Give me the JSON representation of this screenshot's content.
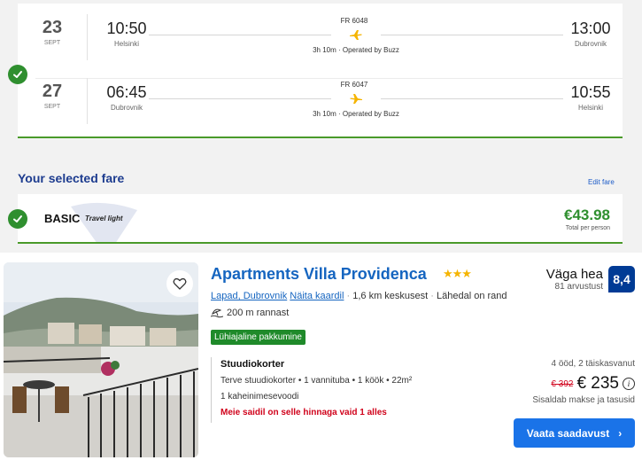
{
  "flights": [
    {
      "day": "23",
      "month": "SEPT",
      "dep_time": "10:50",
      "dep_city": "Helsinki",
      "flight_no": "FR 6048",
      "duration": "3h 10m · Operated by Buzz",
      "arr_time": "13:00",
      "arr_city": "Dubrovnik"
    },
    {
      "day": "27",
      "month": "SEPT",
      "dep_time": "06:45",
      "dep_city": "Dubrovnik",
      "flight_no": "FR 6047",
      "duration": "3h 10m · Operated by Buzz",
      "arr_time": "10:55",
      "arr_city": "Helsinki"
    }
  ],
  "fare": {
    "title": "Your selected fare",
    "edit": "Edit fare",
    "name": "BASIC",
    "subtitle": "Travel light",
    "price": "€43.98",
    "per": "Total per person"
  },
  "hotel": {
    "name": "Apartments Villa Providenca",
    "stars": "★★★",
    "location_link": "Lapad, Dubrovnik",
    "map_link": "Näita kaardil",
    "distance": "1,6 km keskusest",
    "beach_near": "Lähedal on rand",
    "beach_dist": "200 m rannast",
    "deal": "Lühiajaline pakkumine",
    "room": "Stuudiokorter",
    "room_details": "Terve stuudiokorter • 1 vannituba • 1 köök • 22m²",
    "bed": "1 kaheinimesevoodi",
    "availability": "Meie saidil on selle hinnaga vaid 1 alles",
    "rating_label": "Väga hea",
    "reviews": "81 arvustust",
    "score": "8,4",
    "stay": "4 ööd, 2 täiskasvanut",
    "old_price": "€ 392",
    "price": "€ 235",
    "info": "i",
    "taxes": "Sisaldab makse ja tasusid",
    "cta": "Vaata saadavust",
    "cta_arrow": "›"
  },
  "colors": {
    "green": "#2f8f2f",
    "blue": "#1565c0",
    "navy": "#1d3c8f",
    "score_bg": "#003b95",
    "cta": "#1a73e8",
    "red": "#d0021b",
    "plane": "#f5b400"
  },
  "icons": [
    "check-icon",
    "plane-icon",
    "heart-icon",
    "beach-icon",
    "info-icon",
    "chevron-right-icon"
  ]
}
